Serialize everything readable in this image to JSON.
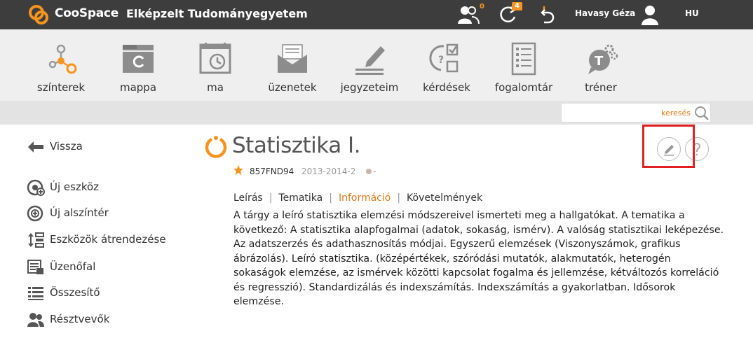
{
  "topbar": {
    "brand": "CooSpace",
    "university": "Elképzelt Tudományegyetem",
    "members_count": "0",
    "refresh_count": "4",
    "user_name": "Havasy Géza",
    "language": "HU"
  },
  "toolbar": {
    "items": [
      {
        "label": "színterek",
        "icon": "network-icon"
      },
      {
        "label": "mappa",
        "icon": "folder-icon"
      },
      {
        "label": "ma",
        "icon": "calendar-icon"
      },
      {
        "label": "üzenetek",
        "icon": "envelope-icon"
      },
      {
        "label": "jegyzeteim",
        "icon": "pencil-notes-icon"
      },
      {
        "label": "kérdések",
        "icon": "quiz-icon"
      },
      {
        "label": "fogalomtár",
        "icon": "glossary-icon"
      },
      {
        "label": "tréner",
        "icon": "trainer-icon"
      }
    ]
  },
  "search": {
    "placeholder": "keresés"
  },
  "sidebar": {
    "back": "Vissza",
    "items": [
      {
        "label": "Új eszköz",
        "icon": "add-tool-icon"
      },
      {
        "label": "Új alszíntér",
        "icon": "add-subscene-icon"
      },
      {
        "label": "Eszközök átrendezése",
        "icon": "reorder-icon"
      },
      {
        "label": "Üzenőfal",
        "icon": "message-board-icon"
      },
      {
        "label": "Összesítő",
        "icon": "summary-icon"
      },
      {
        "label": "Résztvevők",
        "icon": "participants-icon"
      }
    ]
  },
  "course": {
    "title": "Statisztika I.",
    "code": "857FND94",
    "term": "2013-2014-2",
    "status": "-"
  },
  "tabs": [
    {
      "label": "Leírás",
      "active": false
    },
    {
      "label": "Tematika",
      "active": false
    },
    {
      "label": "Információ",
      "active": true
    },
    {
      "label": "Követelmények",
      "active": false
    }
  ],
  "description": "A tárgy a leíró statisztika elemzési módszereivel ismerteti meg a hallgatókat.  A tematika a következő: A statisztika alapfogalmai (adatok, sokaság, ismérv). A valóság statisztikai leképezése. Az adatszerzés és adathasznosítás módjai. Egyszerű elemzések (Viszonyszámok, grafikus ábrázolás). Leíró statisztika. (középértékek, szóródási mutatók, alakmutatók, heterogén sokaságok elemzése, az ismérvek közötti kapcsolat fogalma és jellemzése, kétváltozós korreláció és regresszió). Standardizálás és indexszámítás. Indexszámítás a gyakorlatban. Idősorok elemzése.",
  "colors": {
    "accent": "#e07a1c",
    "topbar": "#3d3d3d",
    "toolbar": "#efefef",
    "highlight": "#e02020"
  }
}
